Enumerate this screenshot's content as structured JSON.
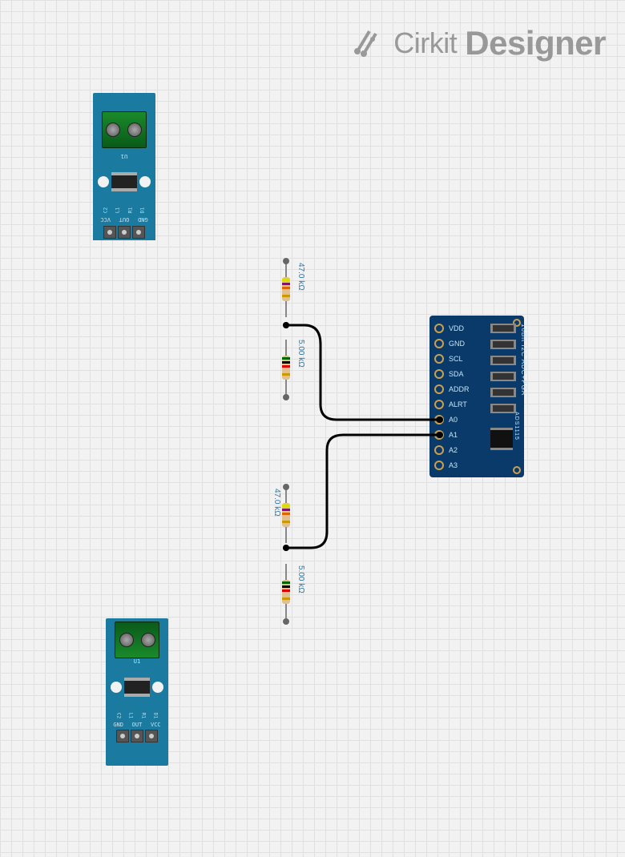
{
  "watermark": {
    "brand": "Cirkit",
    "product": "Designer"
  },
  "acs_module": {
    "pins": [
      "GND",
      "OUT",
      "VCC"
    ],
    "components": [
      "D1",
      "R1",
      "L1",
      "C2"
    ],
    "chip_label": "U1"
  },
  "resistors": {
    "r1": {
      "value": "47.0 kΩ"
    },
    "r2": {
      "value": "5.00 kΩ"
    },
    "r3": {
      "value": "47.0 kΩ"
    },
    "r4": {
      "value": "5.00 kΩ"
    }
  },
  "ads1115": {
    "pins": [
      "VDD",
      "GND",
      "SCL",
      "SDA",
      "ADDR",
      "ALRT",
      "A0",
      "A1",
      "A2",
      "A3"
    ],
    "side_text": "16Bit I2C ADC+PGA",
    "part_label": "ADS1115"
  }
}
